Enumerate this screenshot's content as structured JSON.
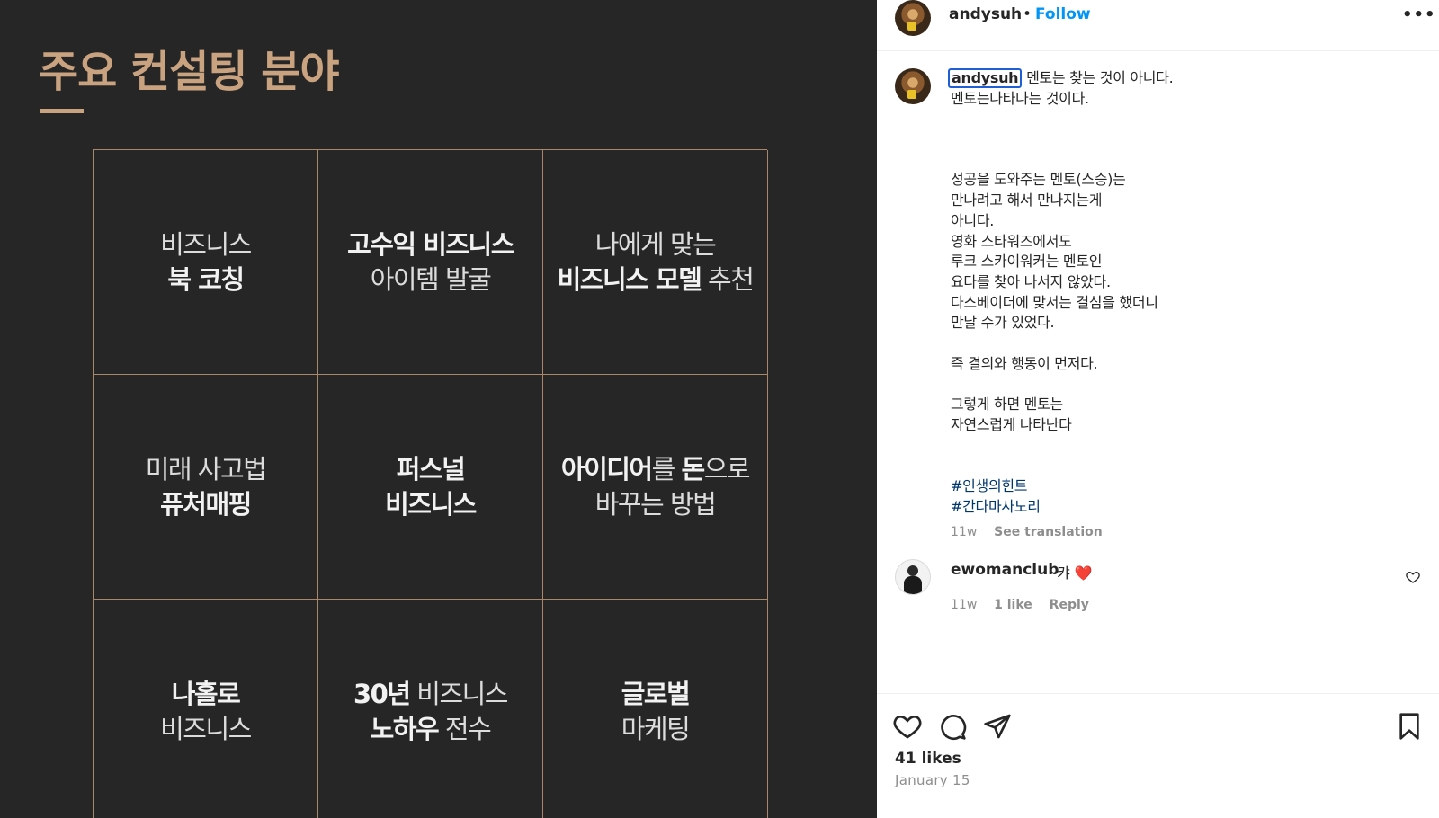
{
  "slide": {
    "title": "주요 컨설팅 분야",
    "cells": [
      {
        "line1": "비즈니스",
        "line2": "북 코칭"
      },
      {
        "line1": "고수익 비즈니스",
        "line2": "아이템 발굴"
      },
      {
        "line1": "나에게 맞는",
        "line2a": "비즈니스 모델",
        "line2b": " 추천"
      },
      {
        "line1": "미래 사고법",
        "line2": "퓨처매핑"
      },
      {
        "line1": "퍼스널",
        "line2": "비즈니스"
      },
      {
        "line1a": "아이디어",
        "line1b": "를 ",
        "line1c": "돈",
        "line1d": "으로",
        "line2": "바꾸는 방법"
      },
      {
        "line1": "나홀로",
        "line2": "비즈니스"
      },
      {
        "line1a": "30년",
        "line1b": " 비즈니스",
        "line2a": "노하우",
        "line2b": " 전수"
      },
      {
        "line1": "글로벌",
        "line2": "마케팅"
      }
    ]
  },
  "header": {
    "username": "andysuh",
    "separator": "•",
    "follow_label": "Follow",
    "more_icon": "•••"
  },
  "caption": {
    "username": "andysuh",
    "lines": [
      "멘토는 찾는 것이 아니다.",
      "멘토는나타나는 것이다.",
      "",
      "",
      "",
      "성공을 도와주는 멘토(스승)는",
      "만나려고 해서 만나지는게",
      "아니다.",
      "영화 스타워즈에서도",
      "루크 스카이워커는 멘토인",
      "요다를 찾아 나서지 않았다.",
      "다스베이더에 맞서는 결심을 했더니",
      "만날 수가 있었다.",
      "",
      "즉 결의와 행동이 먼저다.",
      "",
      "그렇게 하면 멘토는",
      "자연스럽게 나타난다",
      "",
      ""
    ],
    "hashtags": [
      "#인생의힌트",
      "#간다마사노리"
    ],
    "time": "11w",
    "see_translation": "See translation"
  },
  "comment": {
    "username": "ewomanclub",
    "text": "캬 ❤️",
    "time": "11w",
    "likes": "1 like",
    "reply": "Reply"
  },
  "footer": {
    "likes": "41 likes",
    "date": "January 15"
  },
  "colors": {
    "slide_bg": "#262626",
    "slide_accent": "#c9a27f",
    "follow_blue": "#0095f6",
    "hashtag_blue": "#00376b"
  }
}
